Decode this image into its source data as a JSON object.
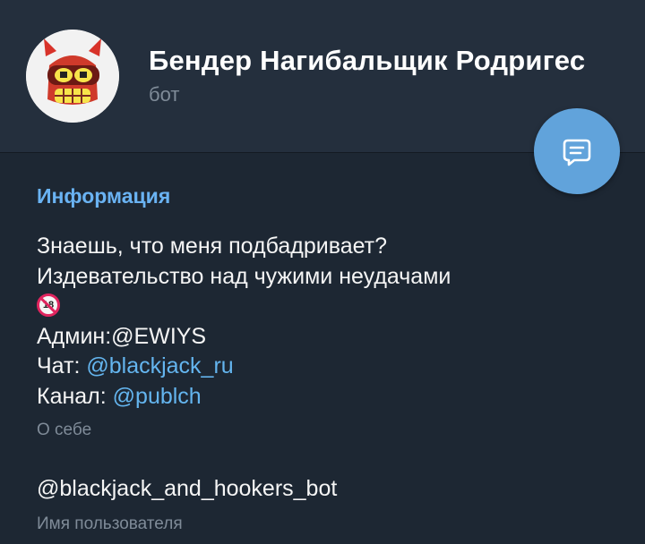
{
  "profile": {
    "name": "Бендер Нагибальщик Родригес",
    "subtitle": "бот"
  },
  "info": {
    "section_title": "Информация",
    "bio_line1": "Знаешь, что меня подбадривает?",
    "bio_line2": "Издевательство над чужими неудачами",
    "emoji_label": "18",
    "emoji_name": "no-one-under-eighteen",
    "admin_text": "Админ:@EWIYS",
    "chat_label": "Чат: ",
    "chat_link": "@blackjack_ru",
    "channel_label": "Канал: ",
    "channel_link": "@publch",
    "bio_hint": "О себе",
    "username": "@blackjack_and_hookers_bot",
    "username_hint": "Имя пользователя"
  },
  "colors": {
    "background": "#1d2733",
    "header": "#242f3d",
    "accent": "#6ab3f3",
    "link": "#64b5ef",
    "fab": "#61a3db",
    "muted": "#7f8b98"
  },
  "icons": {
    "fab": "message-icon"
  }
}
